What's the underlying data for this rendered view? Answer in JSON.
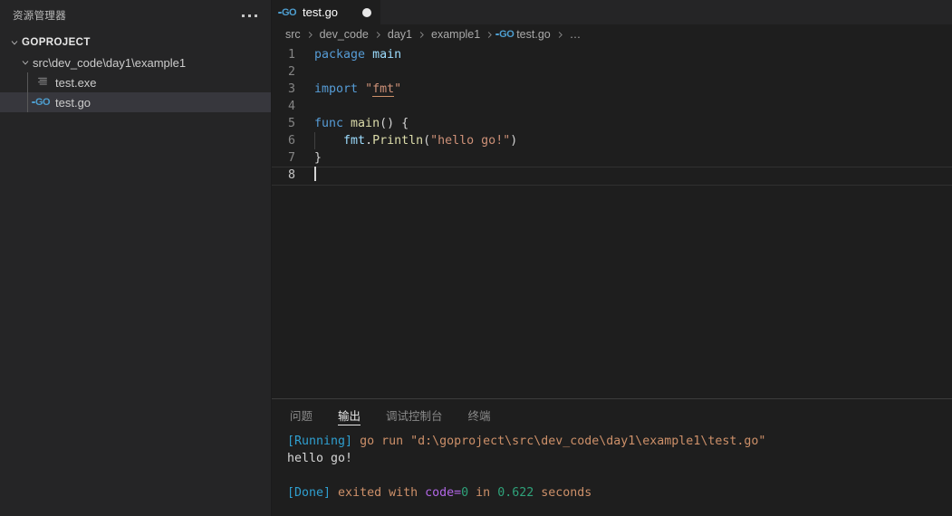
{
  "sidebar": {
    "title": "资源管理器",
    "more_actions_icon": "ellipsis-icon",
    "tree": [
      {
        "label": "GOPROJECT",
        "level": "root",
        "expanded": true,
        "icon": null,
        "selected": false
      },
      {
        "label": "src\\dev_code\\day1\\example1",
        "level": "lvl1",
        "expanded": true,
        "icon": null,
        "selected": false
      },
      {
        "label": "test.exe",
        "level": "lvl2",
        "expanded": null,
        "icon": "binary-file-icon",
        "selected": false
      },
      {
        "label": "test.go",
        "level": "lvl2",
        "expanded": null,
        "icon": "go-file-icon",
        "selected": true
      }
    ]
  },
  "tabs": [
    {
      "label": "test.go",
      "icon": "go-file-icon",
      "active": true,
      "dirty": true
    }
  ],
  "breadcrumb": {
    "separator": "›",
    "items": [
      {
        "label": "src",
        "icon": null
      },
      {
        "label": "dev_code",
        "icon": null
      },
      {
        "label": "day1",
        "icon": null
      },
      {
        "label": "example1",
        "icon": null
      },
      {
        "label": "test.go",
        "icon": "go-file-icon"
      },
      {
        "label": "…",
        "icon": null
      }
    ]
  },
  "editor": {
    "language": "go",
    "active_line": 8,
    "lines": [
      {
        "n": "1",
        "tokens": [
          {
            "t": "package",
            "c": "t-kw"
          },
          {
            "t": " ",
            "c": "t-plain"
          },
          {
            "t": "main",
            "c": "t-var"
          }
        ]
      },
      {
        "n": "2",
        "tokens": []
      },
      {
        "n": "3",
        "tokens": [
          {
            "t": "import",
            "c": "t-kw"
          },
          {
            "t": " ",
            "c": "t-plain"
          },
          {
            "t": "\"",
            "c": "t-str"
          },
          {
            "t": "fmt",
            "c": "t-imp"
          },
          {
            "t": "\"",
            "c": "t-str"
          }
        ]
      },
      {
        "n": "4",
        "tokens": []
      },
      {
        "n": "5",
        "tokens": [
          {
            "t": "func",
            "c": "t-kw"
          },
          {
            "t": " ",
            "c": "t-plain"
          },
          {
            "t": "main",
            "c": "t-fn"
          },
          {
            "t": "() {",
            "c": "t-plain"
          }
        ]
      },
      {
        "n": "6",
        "tokens": [
          {
            "t": "    ",
            "c": "t-plain"
          },
          {
            "t": "fmt",
            "c": "t-var"
          },
          {
            "t": ".",
            "c": "t-plain"
          },
          {
            "t": "Println",
            "c": "t-fn"
          },
          {
            "t": "(",
            "c": "t-plain"
          },
          {
            "t": "\"hello go!\"",
            "c": "t-str"
          },
          {
            "t": ")",
            "c": "t-plain"
          }
        ]
      },
      {
        "n": "7",
        "tokens": [
          {
            "t": "}",
            "c": "t-plain"
          }
        ]
      },
      {
        "n": "8",
        "tokens": []
      }
    ]
  },
  "panel": {
    "tabs": [
      {
        "label": "问题",
        "active": false
      },
      {
        "label": "输出",
        "active": true
      },
      {
        "label": "调试控制台",
        "active": false
      },
      {
        "label": "终端",
        "active": false
      }
    ],
    "output": [
      {
        "segments": [
          {
            "t": "[Running]",
            "c": "o-tag"
          },
          {
            "t": " go run \"d:\\goproject\\src\\dev_code\\day1\\example1\\test.go\"",
            "c": "o-text"
          }
        ]
      },
      {
        "segments": [
          {
            "t": "hello go!",
            "c": "o-out"
          }
        ]
      },
      {
        "segments": []
      },
      {
        "segments": [
          {
            "t": "[Done]",
            "c": "o-tag"
          },
          {
            "t": " exited with ",
            "c": "o-text"
          },
          {
            "t": "code=",
            "c": "o-code"
          },
          {
            "t": "0",
            "c": "o-num"
          },
          {
            "t": " in ",
            "c": "o-text"
          },
          {
            "t": "0.622",
            "c": "o-num"
          },
          {
            "t": " seconds",
            "c": "o-text"
          }
        ]
      }
    ]
  },
  "colors": {
    "editor_bg": "#1e1e1e",
    "sidebar_bg": "#252526",
    "selection_bg": "#37373d",
    "keyword": "#569cd6",
    "function": "#dcdcaa",
    "string": "#ce9178",
    "variable": "#9cdcfe",
    "output_tag": "#2f9fd0",
    "output_code": "#b267e6",
    "output_number": "#2fa27a"
  }
}
